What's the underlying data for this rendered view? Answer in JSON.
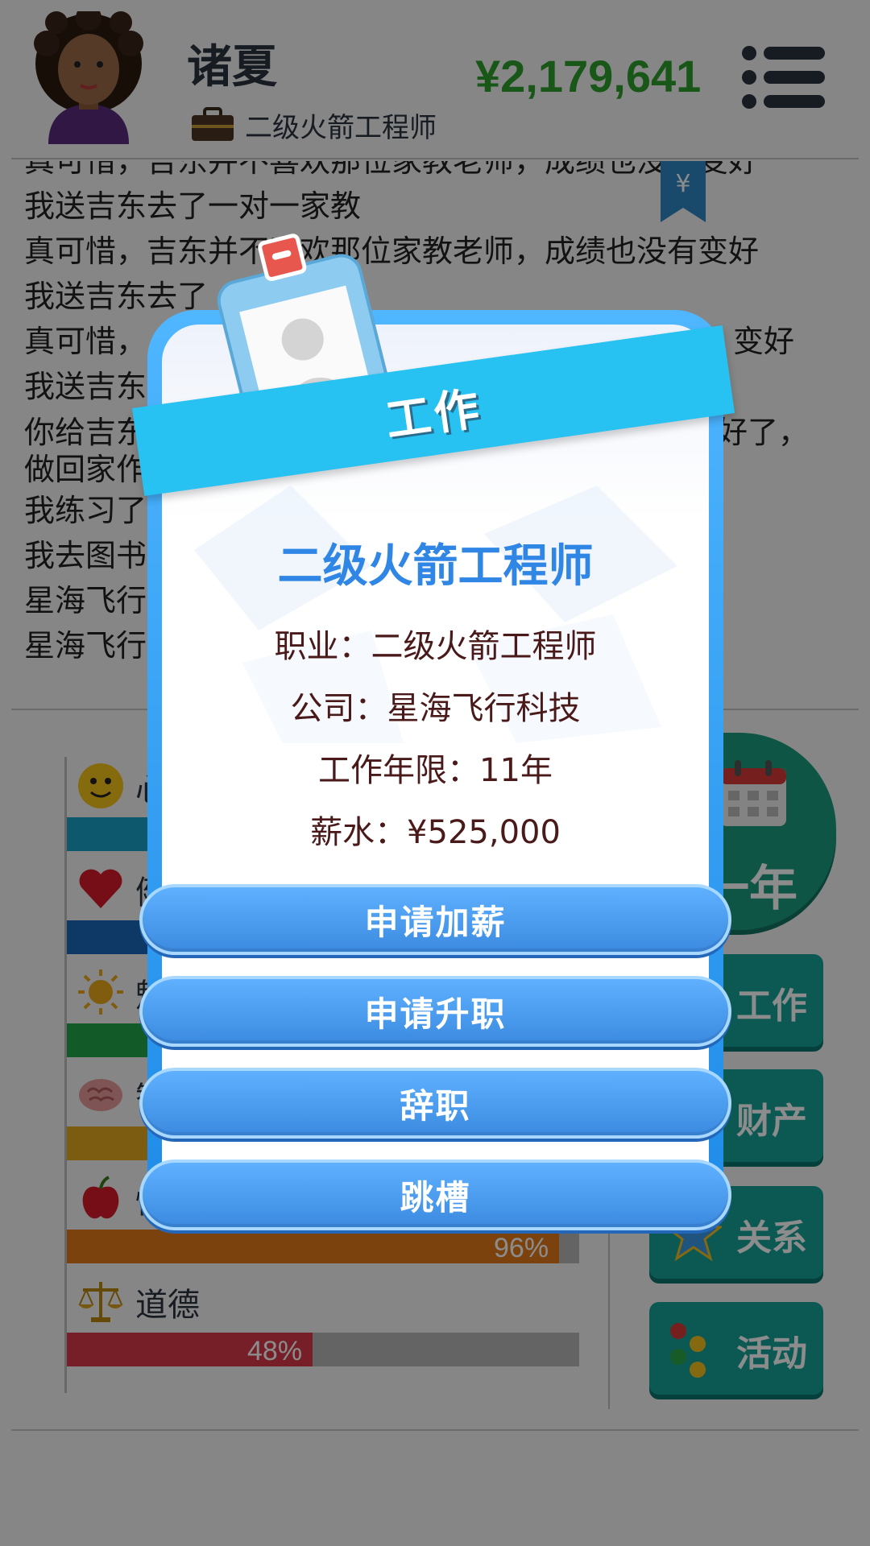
{
  "header": {
    "name": "诸夏",
    "job": "二级火箭工程师",
    "money": "¥2,179,641"
  },
  "log": [
    "真可惜，吉东并不喜欢那位家教老师，成绩也没有变好",
    "我送吉东去了一对一家教",
    "真可惜，吉东并不喜欢那位家教老师，成绩也没有变好",
    "我送吉东去了",
    "真可惜，",
    "我送吉东",
    "你给吉东",
    "我练习了",
    "我去图书",
    "星海飞行",
    "星海飞行"
  ],
  "log_extra": {
    "right_fragment_1": "变好",
    "right_fragment_2": "好了，",
    "wrap_line": "做回家作"
  },
  "stats": [
    {
      "label": "心",
      "percent": null,
      "color": "#1aa0c8"
    },
    {
      "label": "健",
      "percent": null,
      "color": "#1a66b8"
    },
    {
      "label": "魅",
      "percent": null,
      "color": "#22a64a"
    },
    {
      "label": "智",
      "percent": null,
      "color": "#e0a820"
    },
    {
      "label": "快",
      "percent": 96,
      "pct_text": "96%",
      "color": "#e0781a"
    },
    {
      "label": "道德",
      "percent": 48,
      "pct_text": "48%",
      "color": "#d83a4a"
    }
  ],
  "side": {
    "next_year": "一年",
    "work": "工作",
    "assets": "财产",
    "relations": "关系",
    "activities": "活动"
  },
  "modal": {
    "ribbon": "工作",
    "job_title": "二级火箭工程师",
    "occupation": "职业：二级火箭工程师",
    "company": "公司：星海飞行科技",
    "years": "工作年限：11年",
    "salary": "薪水：¥525,000",
    "buttons": [
      "申请加薪",
      "申请升职",
      "辞职",
      "跳槽"
    ]
  },
  "colors": {
    "money": "#2e9e2e",
    "modal_border": "#1e8be8",
    "ribbon": "#27c2f2",
    "button": "#3b8ae0",
    "job_title": "#2f86e4"
  }
}
